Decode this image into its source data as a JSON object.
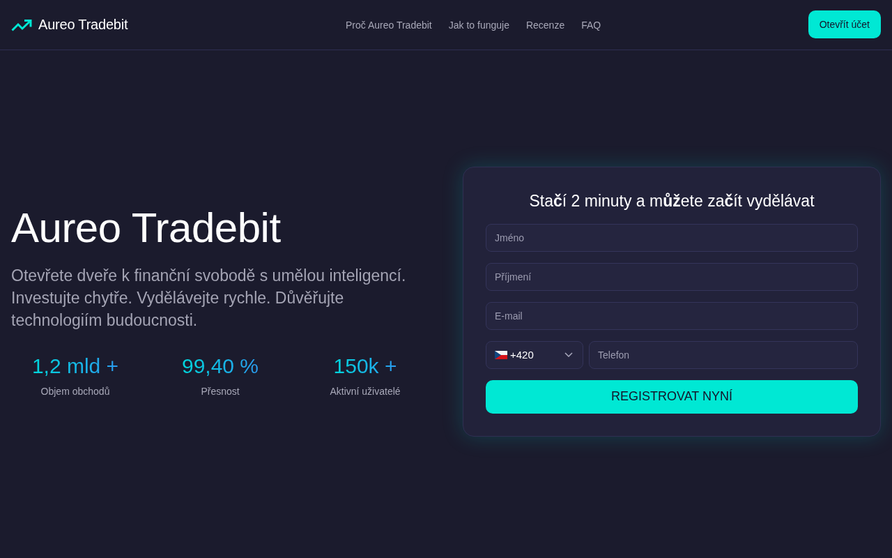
{
  "header": {
    "logo": "Aureo Tradebit",
    "nav": [
      "Proč Aureo Tradebit",
      "Jak to funguje",
      "Recenze",
      "FAQ"
    ],
    "cta": "Otevřít účet"
  },
  "hero": {
    "title": "Aureo Tradebit",
    "subtitle": "Otevřete dveře k finanční svobodě s umělou inteligencí. Investujte chytře. Vydělávejte rychle. Důvěřujte technologiím budoucnosti.",
    "stats": [
      {
        "value": "1,2 mld +",
        "label": "Objem obchodů"
      },
      {
        "value": "99,40 %",
        "label": "Přesnost"
      },
      {
        "value": "150k +",
        "label": "Aktivní uživatelé"
      }
    ]
  },
  "form": {
    "title": "Sta**č**í 2 minuty a m**ůž**ete za**č**ít vydělávat",
    "fields": [
      {
        "placeholder": "Jméno"
      },
      {
        "placeholder": "Příjmení"
      },
      {
        "placeholder": "E-mail"
      }
    ],
    "phone": {
      "code": "+420",
      "placeholder": "Telefon"
    },
    "submit": "REGISTROVAT NYNÍ"
  }
}
